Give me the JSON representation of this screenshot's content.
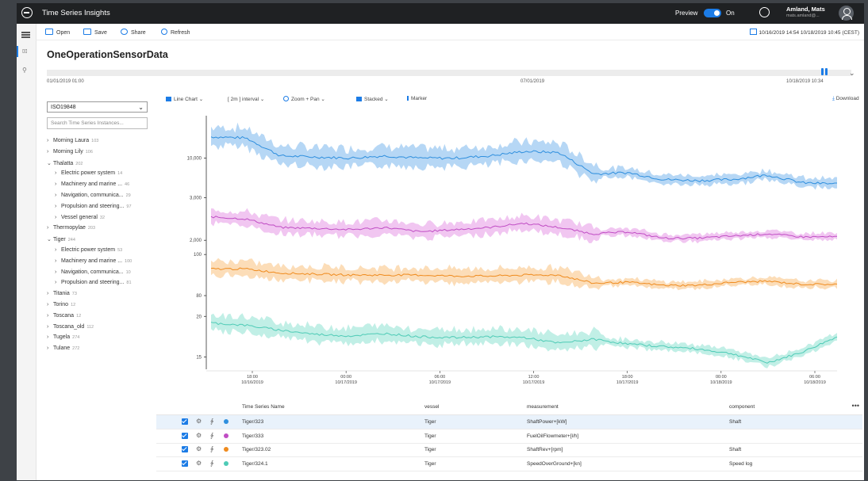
{
  "app": {
    "title": "Time Series Insights"
  },
  "topbar": {
    "preview_label": "Preview",
    "toggle_state": "On",
    "user_name": "Amland, Mats",
    "user_email": "mats.amland@..."
  },
  "commands": {
    "open": "Open",
    "save": "Save",
    "share": "Share",
    "refresh": "Refresh",
    "date_range": "10/16/2019 14:54   10/18/2019 10:45 (CEST)"
  },
  "page": {
    "title": "OneOperationSensorData"
  },
  "timeline": {
    "start": "01/01/2019 01:00",
    "mid": "07/01/2019",
    "end": "10/18/2019 10:34"
  },
  "sidebar": {
    "hierarchy_select": "ISO19848",
    "search_placeholder": "Search Time Series Instances...",
    "items": [
      {
        "label": "Morning Laura",
        "count": "103",
        "expanded": false,
        "level": 0
      },
      {
        "label": "Morning Lily",
        "count": "106",
        "expanded": false,
        "level": 0
      },
      {
        "label": "Thalatta",
        "count": "202",
        "expanded": true,
        "level": 0
      },
      {
        "label": "Electric power system",
        "count": "14",
        "level": 1
      },
      {
        "label": "Machinery and marine ...",
        "count": "46",
        "level": 1
      },
      {
        "label": "Navigation, communica...",
        "count": "29",
        "level": 1
      },
      {
        "label": "Propulsion and steering...",
        "count": "97",
        "level": 1
      },
      {
        "label": "Vessel general",
        "count": "32",
        "level": 1
      },
      {
        "label": "Thermopylae",
        "count": "203",
        "expanded": false,
        "level": 0
      },
      {
        "label": "Tiger",
        "count": "244",
        "expanded": true,
        "level": 0
      },
      {
        "label": "Electric power system",
        "count": "53",
        "level": 1
      },
      {
        "label": "Machinery and marine ...",
        "count": "100",
        "level": 1
      },
      {
        "label": "Navigation, communica...",
        "count": "10",
        "level": 1
      },
      {
        "label": "Propulsion and steering...",
        "count": "81",
        "level": 1
      },
      {
        "label": "Titania",
        "count": "73",
        "expanded": false,
        "level": 0
      },
      {
        "label": "Torino",
        "count": "12",
        "expanded": false,
        "level": 0
      },
      {
        "label": "Toscana",
        "count": "12",
        "expanded": false,
        "level": 0
      },
      {
        "label": "Toscana_old",
        "count": "112",
        "expanded": false,
        "level": 0
      },
      {
        "label": "Tugela",
        "count": "274",
        "expanded": false,
        "level": 0
      },
      {
        "label": "Tulane",
        "count": "272",
        "expanded": false,
        "level": 0
      }
    ]
  },
  "chart_toolbar": {
    "line_chart": "Line Chart",
    "interval": "[ 2m ] interval",
    "zoom": "Zoom + Pan",
    "stacked": "Stacked",
    "marker": "Marker",
    "download": "Download"
  },
  "chart_data": {
    "type": "line",
    "style": "stacked-with-min-max-bands",
    "x_tick_labels": [
      [
        "18:00",
        "10/16/2019"
      ],
      [
        "00:00",
        "10/17/2019"
      ],
      [
        "06:00",
        "10/17/2019"
      ],
      [
        "12:00",
        "10/17/2019"
      ],
      [
        "18:00",
        "10/17/2019"
      ],
      [
        "00:00",
        "10/18/2019"
      ],
      [
        "06:00",
        "10/18/2019"
      ]
    ],
    "series": [
      {
        "color": "#2f8fde",
        "band_color": "#a9d0f3",
        "yticks": [
          "10,000"
        ],
        "yticks_values": [
          10000
        ],
        "ylim": [
          7000,
          13500
        ],
        "avg_points": [
          11900,
          11800,
          10200,
          10100,
          10000,
          10200,
          10000,
          10000,
          10200,
          10600,
          10500,
          8600,
          8700,
          8100,
          8000,
          8100,
          8500,
          7800,
          7700
        ]
      },
      {
        "color": "#c04dc4",
        "band_color": "#eebcee",
        "yticks": [
          "3,000",
          "2,000"
        ],
        "yticks_values": [
          3000,
          2000
        ],
        "ylim": [
          1800,
          3100
        ],
        "avg_points": [
          2550,
          2500,
          2300,
          2280,
          2250,
          2300,
          2200,
          2250,
          2300,
          2400,
          2300,
          2150,
          2200,
          2050,
          2050,
          2100,
          2150,
          2080,
          2080
        ]
      },
      {
        "color": "#ef8b1e",
        "band_color": "#fcd7ac",
        "yticks": [
          "100",
          "80"
        ],
        "yticks_values": [
          100,
          80
        ],
        "ylim": [
          75,
          102
        ],
        "avg_points": [
          93,
          93,
          91,
          90.5,
          90,
          90,
          90,
          89.5,
          89.5,
          90,
          90,
          86,
          86.5,
          85,
          85,
          86.5,
          87,
          85.5,
          85.5
        ]
      },
      {
        "color": "#4ecbb6",
        "band_color": "#b6ece2",
        "yticks": [
          "20",
          "15"
        ],
        "yticks_values": [
          20,
          15
        ],
        "ylim": [
          13.5,
          21
        ],
        "avg_points": [
          19.2,
          18.9,
          18.3,
          17.8,
          17.6,
          17.9,
          17.5,
          17.4,
          17.5,
          17.4,
          16.7,
          17.2,
          16.6,
          16.3,
          16.0,
          15.4,
          14.3,
          15.6,
          17.5
        ]
      }
    ]
  },
  "grid": {
    "headers": {
      "name": "Time Series Name",
      "vessel": "vessel",
      "measurement": "measurement",
      "component": "component"
    },
    "rows": [
      {
        "name": "Tiger/323",
        "vessel": "Tiger",
        "measurement": "ShaftPower+[kW]",
        "component": "Shaft",
        "color": "#2f8fde"
      },
      {
        "name": "Tiger/333",
        "vessel": "Tiger",
        "measurement": "FuelOilFlowmeter+[l/h]",
        "component": "",
        "color": "#c04dc4"
      },
      {
        "name": "Tiger/323.02",
        "vessel": "Tiger",
        "measurement": "ShaftRev+[rpm]",
        "component": "Shaft",
        "color": "#ef8b1e"
      },
      {
        "name": "Tiger/324.1",
        "vessel": "Tiger",
        "measurement": "SpeedOverGround+[kn]",
        "component": "Speed log",
        "color": "#4ecbb6"
      }
    ]
  }
}
